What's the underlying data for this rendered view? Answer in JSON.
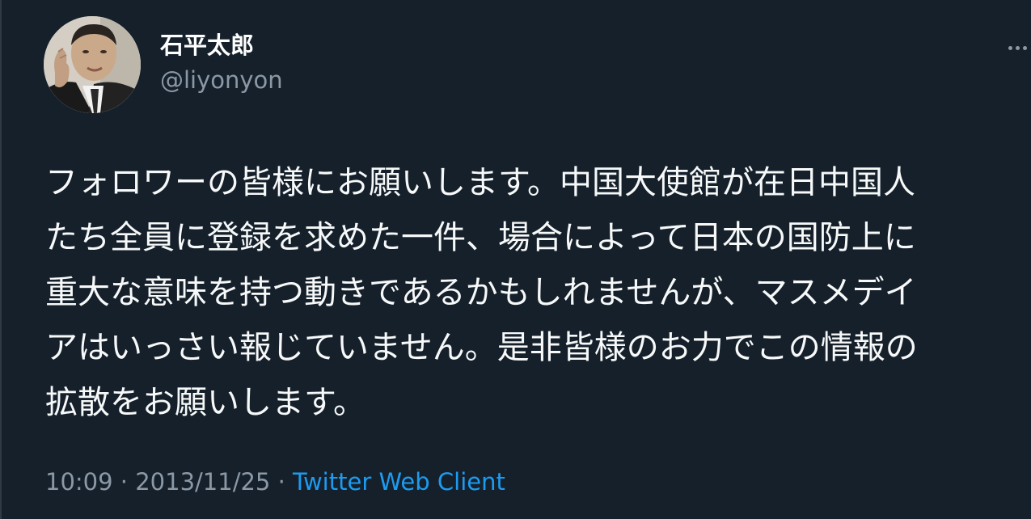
{
  "author": {
    "display_name": "石平太郎",
    "handle": "@liyonyon"
  },
  "tweet": {
    "lines": [
      "フォロワーの皆様にお願いします。中国大使館が在日中国人",
      "たち全員に登録を求めた一件、場合によって日本の国防上に",
      "重大な意味を持つ動きであるかもしれませんが、マスメデイ",
      "アはいっさい報じていません。是非皆様のお力でこの情報の",
      "拡散をお願いします。"
    ]
  },
  "meta": {
    "time": "10:09",
    "separator": " · ",
    "date": "2013/11/25",
    "source": "Twitter Web Client"
  },
  "icons": {
    "more": "more-horizontal-icon"
  },
  "colors": {
    "background": "#15202b",
    "text": "#f7f9f9",
    "secondary": "#8b98a5",
    "link": "#1d9bf0"
  }
}
